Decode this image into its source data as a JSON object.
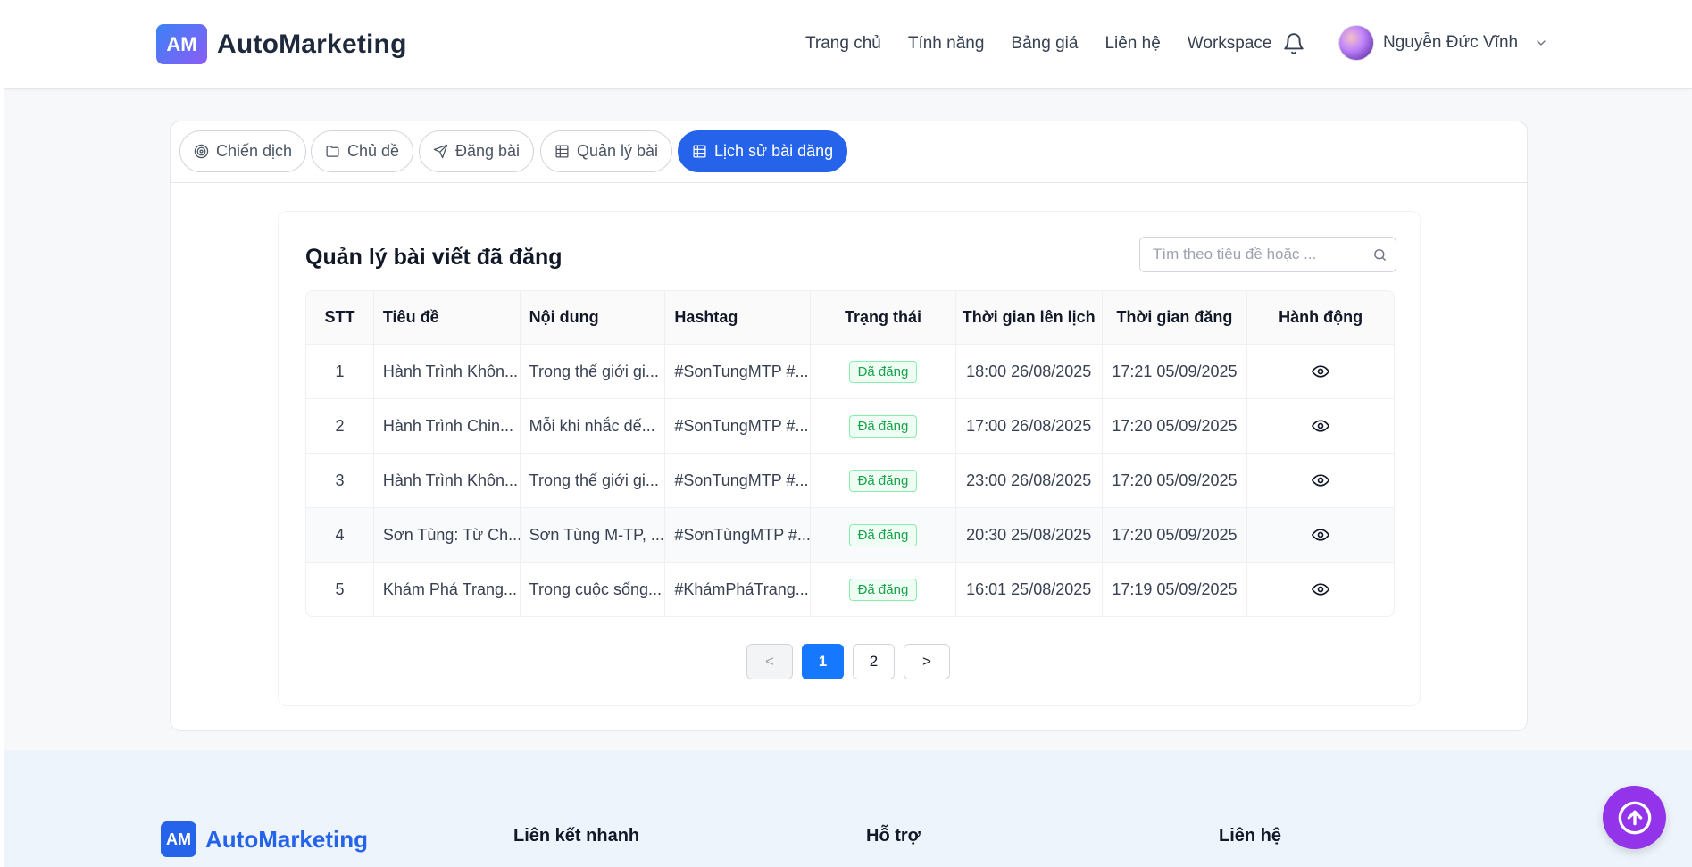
{
  "header": {
    "logo_badge": "AM",
    "logo_text": "AutoMarketing",
    "nav": [
      "Trang chủ",
      "Tính năng",
      "Bảng giá",
      "Liên hệ",
      "Workspace"
    ],
    "user_name": "Nguyễn Đức Vĩnh"
  },
  "tabs": [
    {
      "label": "Chiến dịch",
      "icon": "target-icon"
    },
    {
      "label": "Chủ đề",
      "icon": "folder-icon"
    },
    {
      "label": "Đăng bài",
      "icon": "send-icon"
    },
    {
      "label": "Quản lý bài",
      "icon": "table-icon"
    },
    {
      "label": "Lịch sử bài đăng",
      "icon": "table-icon",
      "active": true
    }
  ],
  "card": {
    "title": "Quản lý bài viết đã đăng",
    "search_placeholder": "Tìm theo tiêu đề hoặc ..."
  },
  "table": {
    "columns": [
      "STT",
      "Tiêu đề",
      "Nội dung",
      "Hashtag",
      "Trạng thái",
      "Thời gian lên lịch",
      "Thời gian đăng",
      "Hành động"
    ],
    "rows": [
      {
        "stt": "1",
        "title": "Hành Trình Khôn...",
        "content": "Trong thế giới gi...",
        "hashtag": "#SonTungMTP #...",
        "status": "Đã đăng",
        "scheduled": "18:00 26/08/2025",
        "posted": "17:21 05/09/2025"
      },
      {
        "stt": "2",
        "title": "Hành Trình Chin...",
        "content": "Mỗi khi nhắc đế...",
        "hashtag": "#SonTungMTP #...",
        "status": "Đã đăng",
        "scheduled": "17:00 26/08/2025",
        "posted": "17:20 05/09/2025"
      },
      {
        "stt": "3",
        "title": "Hành Trình Khôn...",
        "content": "Trong thế giới gi...",
        "hashtag": "#SonTungMTP #...",
        "status": "Đã đăng",
        "scheduled": "23:00 26/08/2025",
        "posted": "17:20 05/09/2025"
      },
      {
        "stt": "4",
        "title": "Sơn Tùng: Từ Ch...",
        "content": "Sơn Tùng M-TP, ...",
        "hashtag": "#SơnTùngMTP #...",
        "status": "Đã đăng",
        "scheduled": "20:30 25/08/2025",
        "posted": "17:20 05/09/2025"
      },
      {
        "stt": "5",
        "title": "Khám Phá Trang...",
        "content": "Trong cuộc sống...",
        "hashtag": "#KhámPháTrang...",
        "status": "Đã đăng",
        "scheduled": "16:01 25/08/2025",
        "posted": "17:19 05/09/2025"
      }
    ]
  },
  "pagination": {
    "prev": "<",
    "pages": [
      "1",
      "2"
    ],
    "active": "1",
    "next": ">"
  },
  "footer": {
    "logo_badge": "AM",
    "logo_text": "AutoMarketing",
    "columns": [
      "Liên kết nhanh",
      "Hỗ trợ",
      "Liên hệ"
    ]
  },
  "colors": {
    "primary": "#2563eb",
    "success": "#16a34a",
    "scroll_top": "#9333ea"
  }
}
